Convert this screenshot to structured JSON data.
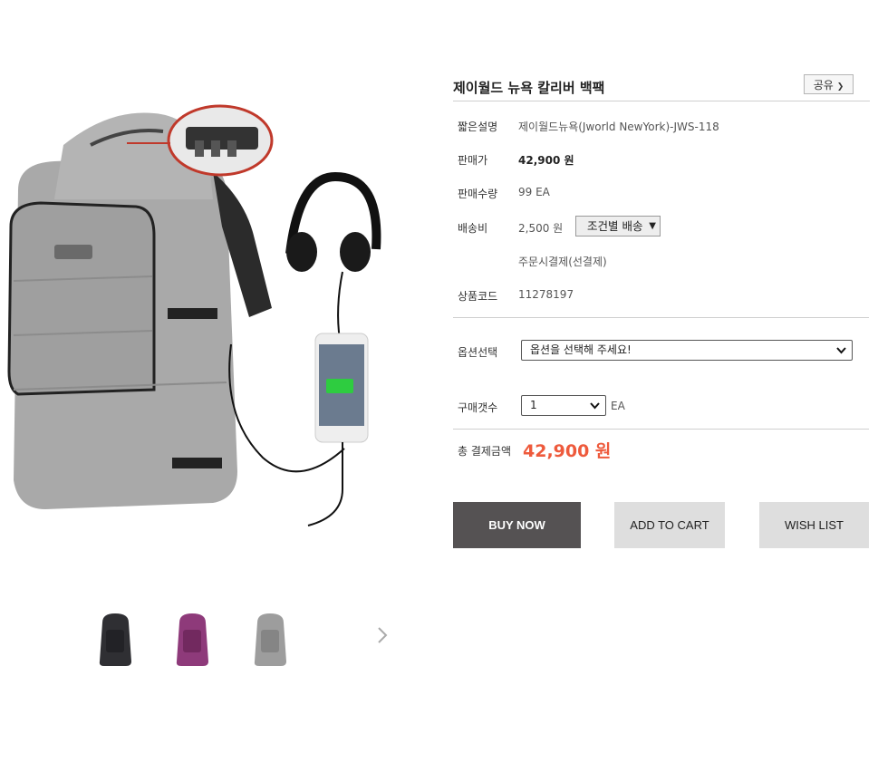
{
  "product": {
    "title": "제이월드 뉴욕 칼리버 백팩",
    "share_label": "공유"
  },
  "details": {
    "short_desc": {
      "label": "짧은설명",
      "value": "제이월드뉴욕(Jworld NewYork)-JWS-118"
    },
    "price": {
      "label": "판매가",
      "value": "42,900 원"
    },
    "sold": {
      "label": "판매수량",
      "value": "99 EA"
    },
    "shipping": {
      "label": "배송비",
      "value": "2,500 원",
      "option": "조건별 배송"
    },
    "payment_note": "주문시결제(선결제)",
    "code": {
      "label": "상품코드",
      "value": "11278197"
    }
  },
  "options": {
    "label": "옵션선택",
    "placeholder": "옵션을 선택해 주세요!"
  },
  "quantity": {
    "label": "구매갯수",
    "value": "1",
    "unit": "EA"
  },
  "total": {
    "label": "총 결제금액",
    "value": "42,900 원"
  },
  "buttons": {
    "buy": "BUY NOW",
    "cart": "ADD TO CART",
    "wish": "WISH LIST"
  },
  "thumbnails": [
    {
      "name": "black-backpack",
      "color": "#2f2f33"
    },
    {
      "name": "purple-backpack",
      "color": "#8e3a7a"
    },
    {
      "name": "gray-backpack",
      "color": "#9d9d9d"
    }
  ],
  "colors": {
    "accent_price": "#ee5a3c",
    "buy_button": "#555253",
    "secondary_button": "#dedede"
  }
}
